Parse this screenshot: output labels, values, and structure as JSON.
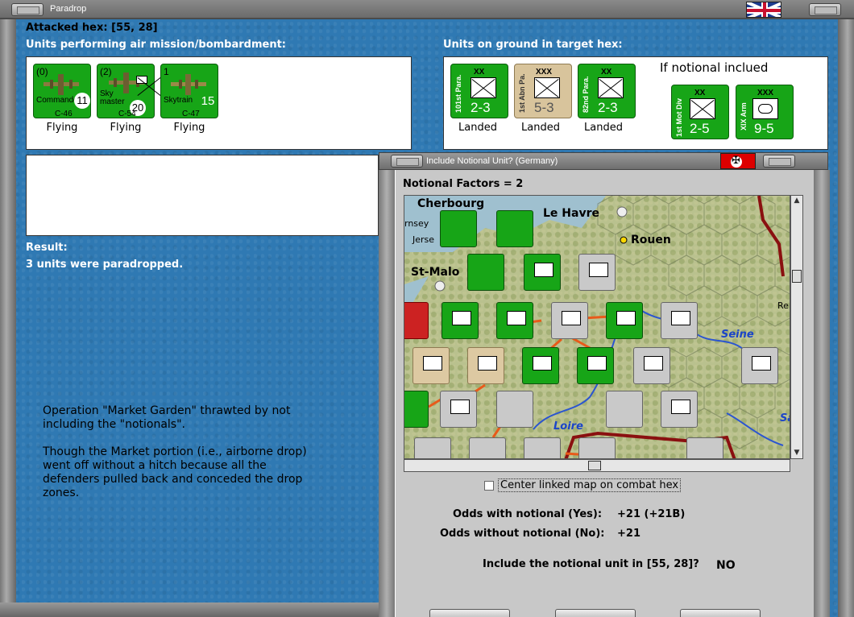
{
  "window": {
    "title": "Paradrop"
  },
  "attacked_hex": "Attacked hex:  [55, 28]",
  "air_section": {
    "label": "Units performing air mission/bombardment:",
    "units": [
      {
        "top": "(0)",
        "name": "Commando",
        "circle": "11",
        "type": "C-46",
        "status": "Flying"
      },
      {
        "top": "(2)",
        "name": "Sky master",
        "circle": "20",
        "type": "C-54",
        "status": "Flying"
      },
      {
        "top": "1",
        "name": "Skytrain",
        "circle": "15",
        "type": "C-47",
        "status": "Flying"
      }
    ]
  },
  "ground_section": {
    "label": "Units on ground in target hex:",
    "units": [
      {
        "size": "XX",
        "name": "101st Para.",
        "value": "2-3",
        "status": "Landed"
      },
      {
        "size": "XXX",
        "name": "1st Abn Pa.",
        "value": "5-3",
        "status": "Landed"
      },
      {
        "size": "XX",
        "name": "82nd Para.",
        "value": "2-3",
        "status": "Landed"
      }
    ],
    "notional_label": "If notional inclued",
    "notional_units": [
      {
        "size": "XX",
        "name": "1st Mot Div",
        "value": "2-5"
      },
      {
        "size": "XXX",
        "name": "XIX Arm",
        "value": "9-5"
      }
    ]
  },
  "result": {
    "label": "Result:",
    "text": "3 units were paradropped."
  },
  "message": {
    "p1": "Operation \"Market Garden\" thrawted by not\nincluding the \"notionals\".",
    "p2": "Though the Market portion (i.e., airborne drop)\nwent off without a hitch because all the\ndefenders pulled back and conceded the drop\nzones."
  },
  "dialog": {
    "title": "Include Notional Unit? (Germany)",
    "notional_factors": "Notional Factors = 2",
    "map": {
      "cities": [
        "Cherbourg",
        "Le Havre",
        "Rouen",
        "St-Malo",
        "Jerse",
        "rnsey",
        "Re"
      ],
      "rivers": [
        "Seine",
        "Loire",
        "Sa"
      ]
    },
    "checkbox_label": "Center linked map on combat hex",
    "odds_yes_label": "Odds with notional (Yes):",
    "odds_yes_value": "+21 (+21B)",
    "odds_no_label": "Odds without notional (No):",
    "odds_no_value": "+21",
    "question": "Include the notional unit in  [55, 28]?",
    "answer": "NO"
  },
  "colors": {
    "background": "#2f79b3",
    "allied_green": "#17a517",
    "airborne_tan": "#d8c49c",
    "axis_grey": "#c9c9c9",
    "river_blue": "#1b45c8"
  }
}
